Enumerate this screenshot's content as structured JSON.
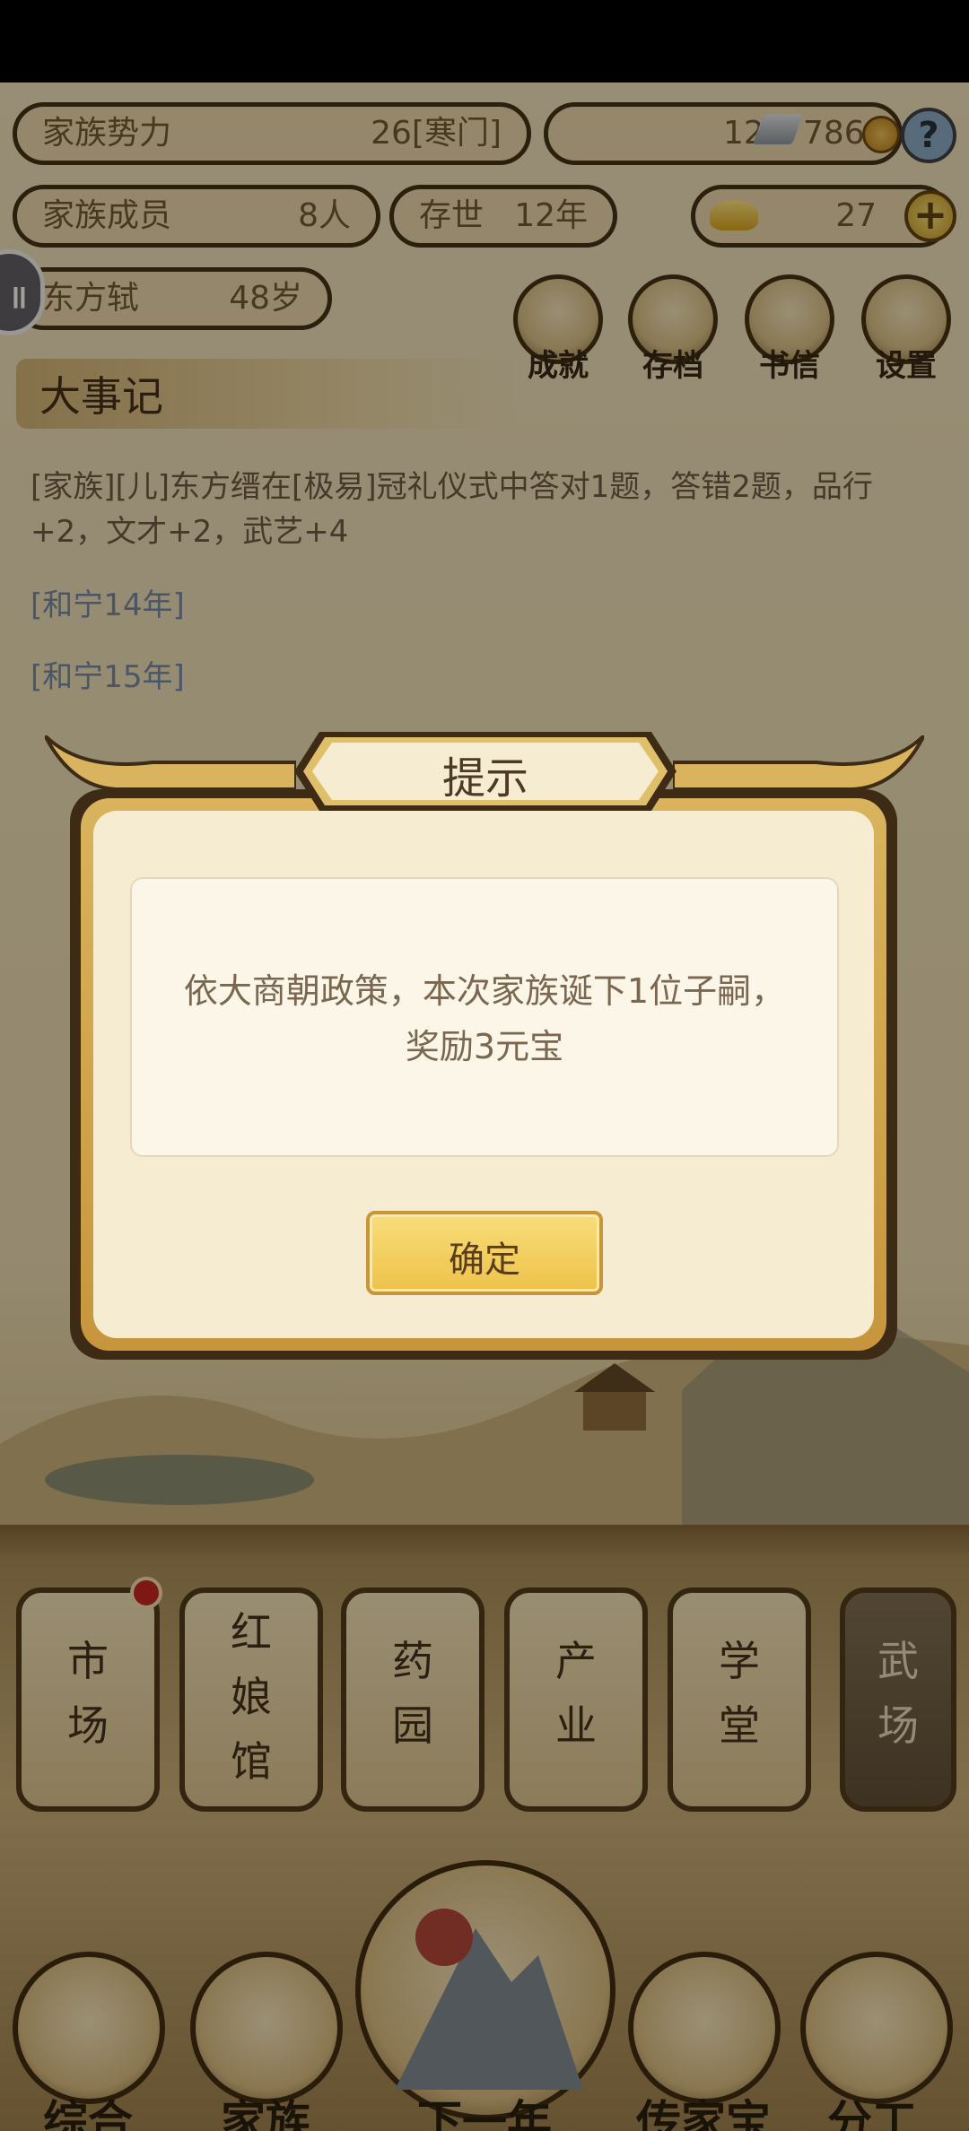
{
  "top": {
    "family_power_label": "家族势力",
    "family_power_value": "26[寒门]",
    "silver": "12",
    "copper": "786",
    "help": "?",
    "members_label": "家族成员",
    "members_value": "8人",
    "existence_label": "存世",
    "existence_value": "12年",
    "gold_ingot": "27",
    "add": "+",
    "leader_name": "东方轼",
    "leader_age": "48岁"
  },
  "menu": {
    "achievements": "成就",
    "save": "存档",
    "letters": "书信",
    "settings": "设置"
  },
  "chronicle": {
    "title": "大事记",
    "entry1": "[家族][儿]东方缙在[极易]冠礼仪式中答对1题，答错2题，品行+2，文才+2，武艺+4",
    "year14": "[和宁14年]",
    "year15": "[和宁15年]"
  },
  "dialog": {
    "title": "提示",
    "message": "依大商朝政策，本次家族诞下1位子嗣，奖励3元宝",
    "confirm": "确定"
  },
  "buildings": [
    {
      "label": "市\n场"
    },
    {
      "label": "红\n娘\n馆"
    },
    {
      "label": "药\n园"
    },
    {
      "label": "产\n业"
    },
    {
      "label": "学\n堂"
    },
    {
      "label": "武\n场"
    }
  ],
  "nav": {
    "general": "综合",
    "family": "家族",
    "next_year": "下一年",
    "heirloom": "传家宝",
    "division": "分工"
  },
  "side": {
    "pause": "॥"
  }
}
